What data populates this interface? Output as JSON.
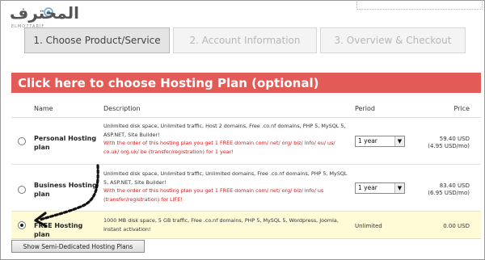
{
  "brand": {
    "logo_text": "المحترف",
    "logo_sub": "ELMO7TARIF"
  },
  "steps": [
    {
      "label": "1. Choose Product/Service"
    },
    {
      "label": "2. Account Information"
    },
    {
      "label": "3. Overview & Checkout"
    }
  ],
  "banner": {
    "label": "Click here to choose Hosting Plan (optional)"
  },
  "table": {
    "headers": {
      "name": "Name",
      "description": "Description",
      "period": "Period",
      "price": "Price"
    },
    "rows": [
      {
        "name": "Personal Hosting plan",
        "desc": "Unlimited disk space, Unlimited traffic, Host 2 domains, Free .co.nf domains, PHP 5, MySQL 5, ASP.NET, Site Builder!",
        "promo": "With the order of this hosting plan you get 1 FREE domain com/ net/ org/ biz/ info/ eu/ us/ co.uk/ org.uk/ be (transfer/registration) for 1 year!",
        "period": "1 year",
        "price": "59.40 USD",
        "price_sub": "(4.95 USD/mo)",
        "selected": false
      },
      {
        "name": "Business Hosting plan",
        "desc": "Unlimited disk space, Unlimited traffic, Unlimited domains, Free .co.nf domains, PHP 5, MySQL 5, ASP.NET, Site Builder!",
        "promo": "With the order of this hosting plan you get 1 FREE domain com/ net/ org/ biz/ info/ us (transfer/registration) for LIFE!",
        "period": "1 year",
        "price": "83.40 USD",
        "price_sub": "(6.95 USD/mo)",
        "selected": false
      },
      {
        "name": "FREE Hosting plan",
        "desc": "1000 MB disk space, 5 GB traffic, Free .co.nf domains, PHP 5, MySQL 5, Wordpress, Joomla, Instant activation!",
        "promo": "",
        "period": "Unlimited",
        "price": "0.00 USD",
        "price_sub": "",
        "selected": true
      }
    ]
  },
  "semi_dedicated_button": {
    "label": "Show Semi-Dedicated Hosting Plans"
  },
  "colors": {
    "banner": "#e25b57",
    "selected_row": "#fefbd6",
    "promo_text": "#cc2222"
  },
  "icons": {
    "dropdown": "chevron-down-icon",
    "annotation": "dotted-arrow-icon"
  }
}
